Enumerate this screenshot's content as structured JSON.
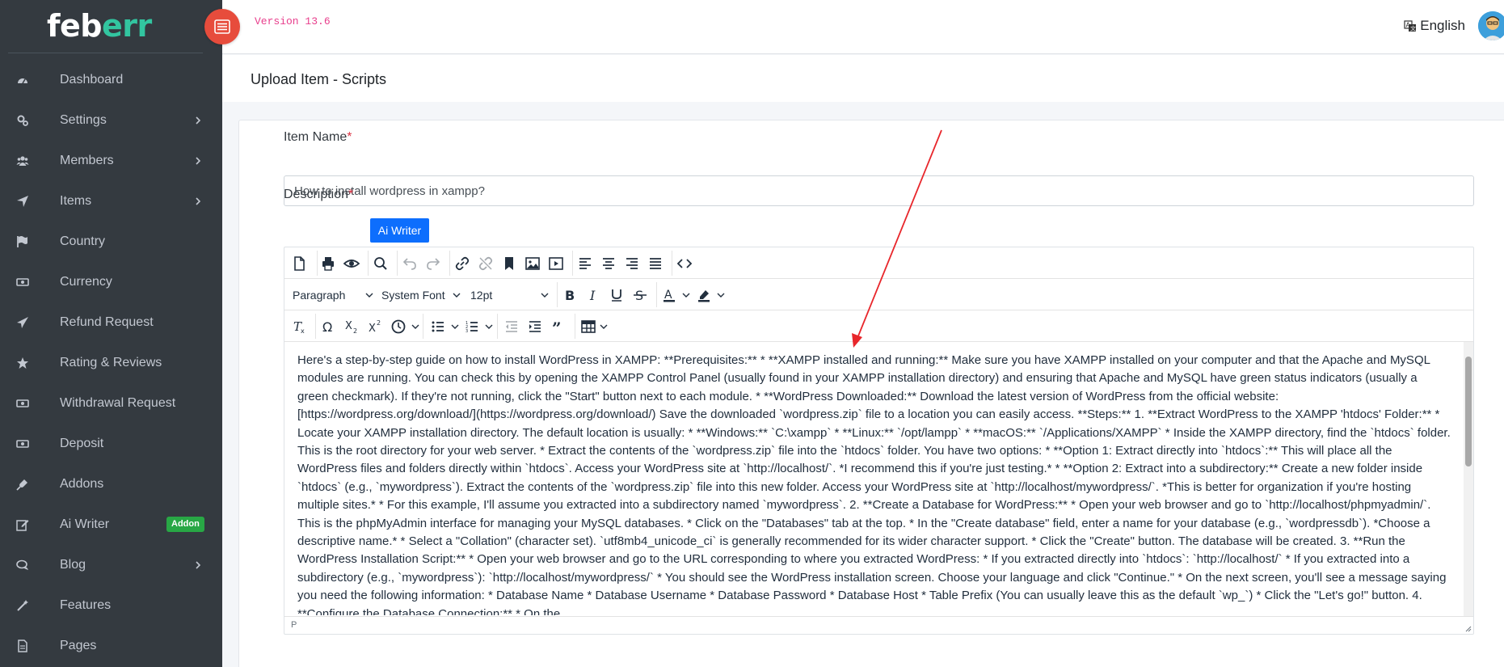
{
  "brand": {
    "part1": "feb",
    "part2": "err"
  },
  "sidebar": {
    "items": [
      {
        "label": "Dashboard",
        "icon": "dashboard-icon",
        "chevron": false
      },
      {
        "label": "Settings",
        "icon": "gears-icon",
        "chevron": true
      },
      {
        "label": "Members",
        "icon": "users-icon",
        "chevron": true
      },
      {
        "label": "Items",
        "icon": "location-arrow-icon",
        "chevron": true
      },
      {
        "label": "Country",
        "icon": "flag-icon",
        "chevron": false
      },
      {
        "label": "Currency",
        "icon": "money-icon",
        "chevron": false
      },
      {
        "label": "Refund Request",
        "icon": "paper-plane-icon",
        "chevron": false
      },
      {
        "label": "Rating & Reviews",
        "icon": "star-icon",
        "chevron": false
      },
      {
        "label": "Withdrawal Request",
        "icon": "money-icon",
        "chevron": false
      },
      {
        "label": "Deposit",
        "icon": "money-icon",
        "chevron": false
      },
      {
        "label": "Addons",
        "icon": "plug-icon",
        "chevron": false
      },
      {
        "label": "Ai Writer",
        "icon": "edit-icon",
        "chevron": false,
        "badge": "Addon"
      },
      {
        "label": "Blog",
        "icon": "comments-icon",
        "chevron": true
      },
      {
        "label": "Features",
        "icon": "magic-icon",
        "chevron": false
      },
      {
        "label": "Pages",
        "icon": "file-icon",
        "chevron": false
      }
    ]
  },
  "topbar": {
    "version": "Version 13.6",
    "language": "English"
  },
  "page": {
    "title": "Upload Item - Scripts"
  },
  "form": {
    "item_name_label": "Item Name",
    "item_name_value": "How to install wordpress in xampp?",
    "description_label": "Description",
    "required_mark": "*",
    "ai_writer_button": "Ai Writer"
  },
  "editor": {
    "block_format": "Paragraph",
    "font_family": "System Font",
    "font_size": "12pt",
    "status_path": "P",
    "content": "Here's a step-by-step guide on how to install WordPress in XAMPP: **Prerequisites:** * **XAMPP installed and running:** Make sure you have XAMPP installed on your computer and that the Apache and MySQL modules are running. You can check this by opening the XAMPP Control Panel (usually found in your XAMPP installation directory) and ensuring that Apache and MySQL have green status indicators (usually a green checkmark). If they're not running, click the \"Start\" button next to each module. * **WordPress Downloaded:** Download the latest version of WordPress from the official website: [https://wordpress.org/download/](https://wordpress.org/download/) Save the downloaded `wordpress.zip` file to a location you can easily access. **Steps:** 1. **Extract WordPress to the XAMPP 'htdocs' Folder:** * Locate your XAMPP installation directory. The default location is usually: * **Windows:** `C:\\xampp` * **Linux:** `/opt/lampp` * **macOS:** `/Applications/XAMPP` * Inside the XAMPP directory, find the `htdocs` folder. This is the root directory for your web server. * Extract the contents of the `wordpress.zip` file into the `htdocs` folder. You have two options: * **Option 1: Extract directly into `htdocs`:** This will place all the WordPress files and folders directly within `htdocs`. Access your WordPress site at `http://localhost/`. *I recommend this if you're just testing.* * **Option 2: Extract into a subdirectory:** Create a new folder inside `htdocs` (e.g., `mywordpress`). Extract the contents of the `wordpress.zip` file into this new folder. Access your WordPress site at `http://localhost/mywordpress/`. *This is better for organization if you're hosting multiple sites.* * For this example, I'll assume you extracted into a subdirectory named `mywordpress`. 2. **Create a Database for WordPress:** * Open your web browser and go to `http://localhost/phpmyadmin/`. This is the phpMyAdmin interface for managing your MySQL databases. * Click on the \"Databases\" tab at the top. * In the \"Create database\" field, enter a name for your database (e.g., `wordpressdb`). *Choose a descriptive name.* * Select a \"Collation\" (character set). `utf8mb4_unicode_ci` is generally recommended for its wider character support. * Click the \"Create\" button. The database will be created. 3. **Run the WordPress Installation Script:** * Open your web browser and go to the URL corresponding to where you extracted WordPress: * If you extracted directly into `htdocs`: `http://localhost/` * If you extracted into a subdirectory (e.g., `mywordpress`): `http://localhost/mywordpress/` * You should see the WordPress installation screen. Choose your language and click \"Continue.\" * On the next screen, you'll see a message saying you need the following information: * Database Name * Database Username * Database Password * Database Host * Table Prefix (You can usually leave this as the default `wp_`) * Click the \"Let's go!\" button. 4. **Configure the Database Connection:** * On the"
  },
  "colors": {
    "sidebar_bg": "#343a40",
    "brand_accent": "#32c5a0",
    "toggle_bg": "#e74c3c",
    "version_color": "#e83e8c",
    "primary": "#0d6efd",
    "addon_badge": "#28a745",
    "annotation_arrow": "#e8262b"
  }
}
